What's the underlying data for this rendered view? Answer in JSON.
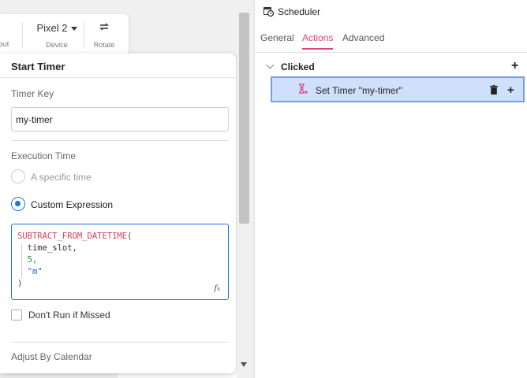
{
  "toolbar": {
    "output_label": "put",
    "device": {
      "value": "Pixel 2",
      "label": "Device"
    },
    "rotate": {
      "label": "Rotate"
    }
  },
  "popover": {
    "title": "Start Timer",
    "timer_key": {
      "label": "Timer Key",
      "value": "my-timer"
    },
    "execution_time": {
      "label": "Execution Time",
      "options": [
        {
          "label": "A specific time",
          "checked": false,
          "disabled": true
        },
        {
          "label": "Custom Expression",
          "checked": true,
          "disabled": false
        }
      ]
    },
    "expression": {
      "fn": "SUBTRACT_FROM_DATETIME",
      "open": "(",
      "arg1": "time_slot,",
      "arg2": "5,",
      "arg3": "\"m\"",
      "close": ")"
    },
    "dont_run_if_missed": {
      "label": "Don't Run if Missed",
      "checked": false
    },
    "adjust_by_calendar": {
      "label": "Adjust By Calendar"
    }
  },
  "right_panel": {
    "title": "Scheduler",
    "tabs": [
      {
        "label": "General",
        "active": false
      },
      {
        "label": "Actions",
        "active": true
      },
      {
        "label": "Advanced",
        "active": false
      }
    ],
    "section": {
      "title": "Clicked"
    },
    "action_item": {
      "label": "Set Timer \"my-timer\""
    }
  },
  "colors": {
    "accent_pink": "#e0427a",
    "accent_blue": "#1a73e8",
    "selected_bg": "#cfe0fb"
  }
}
